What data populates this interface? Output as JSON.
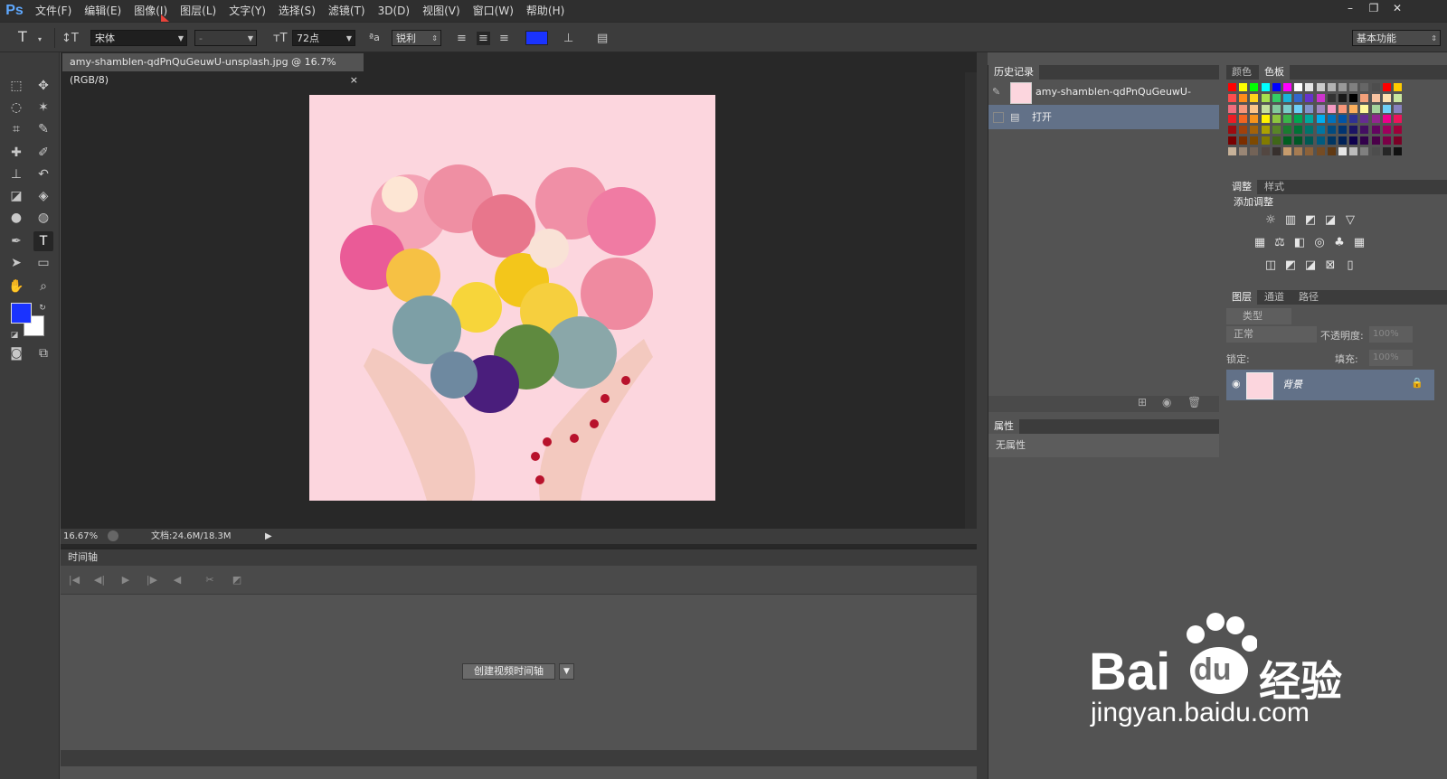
{
  "app": {
    "logo": "Ps"
  },
  "menu": [
    "文件(F)",
    "编辑(E)",
    "图像(I)",
    "图层(L)",
    "文字(Y)",
    "选择(S)",
    "滤镜(T)",
    "3D(D)",
    "视图(V)",
    "窗口(W)",
    "帮助(H)"
  ],
  "options": {
    "font_family": "宋体",
    "font_style": "-",
    "font_size": "72点",
    "antialias": "锐利",
    "text_color": "#1a33ff",
    "workspace": "基本功能"
  },
  "document": {
    "tab_title": "amy-shamblen-qdPnQuGeuwU-unsplash.jpg @ 16.7%(RGB/8)",
    "zoom": "16.67%",
    "doc_size": "文档:24.6M/18.3M",
    "canvas_color": "#fcd6de"
  },
  "timeline": {
    "title": "时间轴",
    "create_button": "创建视频时间轴"
  },
  "history": {
    "tab": "历史记录",
    "snapshot": "amy-shamblen-qdPnQuGeuwU-unspl...",
    "step": "打开"
  },
  "properties": {
    "tab": "属性",
    "empty_text": "无属性"
  },
  "color_panel": {
    "tabs": [
      "颜色",
      "色板"
    ]
  },
  "adjust_panel": {
    "tabs": [
      "调整",
      "样式"
    ],
    "title": "添加调整"
  },
  "layers_panel": {
    "tabs": [
      "图层",
      "通道",
      "路径"
    ],
    "filter": "类型",
    "blend_mode": "正常",
    "opacity_label": "不透明度:",
    "opacity_value": "100%",
    "lock_label": "锁定:",
    "fill_label": "填充:",
    "fill_value": "100%",
    "layer_name": "背景"
  },
  "tool_colors": {
    "foreground": "#1a33ff",
    "background": "#ffffff"
  },
  "watermark": {
    "brand": "Bai",
    "brand2": "du",
    "cn": "经验",
    "url": "jingyan.baidu.com"
  }
}
